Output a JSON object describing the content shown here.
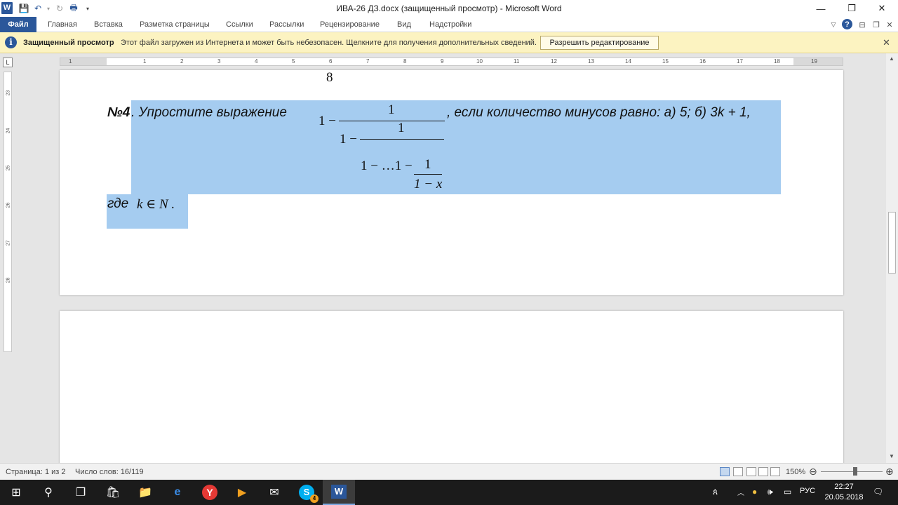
{
  "window": {
    "title": "ИВА-26 ДЗ.docx (защищенный просмотр)  -  Microsoft Word",
    "app_icon": "W",
    "controls": {
      "minimize": "—",
      "restore": "❐",
      "close": "✕"
    }
  },
  "ribbon": {
    "tabs": [
      "Файл",
      "Главная",
      "Вставка",
      "Разметка страницы",
      "Ссылки",
      "Рассылки",
      "Рецензирование",
      "Вид",
      "Надстройки"
    ],
    "active_tab": "Файл"
  },
  "protected_view": {
    "title": "Защищенный просмотр",
    "message": "Этот файл загружен из Интернета и может быть небезопасен. Щелкните для получения дополнительных сведений.",
    "enable_button": "Разрешить редактирование"
  },
  "rulers": {
    "horizontal_ticks": [
      "1",
      "1",
      "2",
      "3",
      "4",
      "5",
      "6",
      "7",
      "8",
      "9",
      "10",
      "11",
      "12",
      "13",
      "14",
      "15",
      "16",
      "17",
      "18",
      "19"
    ],
    "vertical_ticks": [
      "23",
      "24",
      "25",
      "26",
      "27",
      "28"
    ]
  },
  "document": {
    "prev_fragment": "8",
    "problem_number": "№4",
    "problem_intro": ". Упростите выражение",
    "problem_condition": ", если количество минусов равно: а) 5; б) 3k + 1,",
    "where_prefix": "где",
    "where_math": "k ∈ N .",
    "fraction": {
      "one_minus_1": "1 −",
      "num_1": "1",
      "one_minus_2": "1 −",
      "num_2": "1",
      "tail": "1 − …1 −",
      "num_3": "1",
      "den_3": "1 − x"
    }
  },
  "status": {
    "page": "Страница: 1 из 2",
    "words": "Число слов: 16/119",
    "zoom": "150%"
  },
  "taskbar": {
    "keyboard_lang": "РУС",
    "time": "22:27",
    "date": "20.05.2018",
    "skype_badge": "4"
  },
  "colors": {
    "word_blue": "#2b579a",
    "protected_bar": "#fcf3c1",
    "selection": "#a5ccf0"
  }
}
